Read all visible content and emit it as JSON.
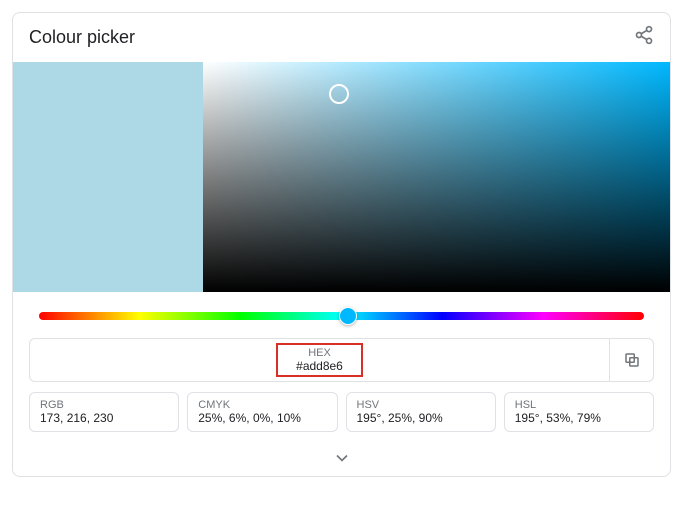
{
  "title": "Colour picker",
  "selected_color": "#add8e6",
  "hue_thumb_color": "#00b8ff",
  "hex": {
    "label": "HEX",
    "value": "#add8e6"
  },
  "formats": [
    {
      "label": "RGB",
      "value": "173, 216, 230"
    },
    {
      "label": "CMYK",
      "value": "25%, 6%, 0%, 10%"
    },
    {
      "label": "HSV",
      "value": "195°, 25%, 90%"
    },
    {
      "label": "HSL",
      "value": "195°, 53%, 79%"
    }
  ]
}
